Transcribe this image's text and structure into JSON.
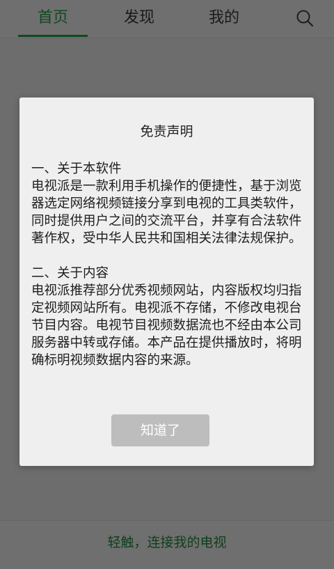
{
  "nav": {
    "tabs": [
      {
        "label": "首页"
      },
      {
        "label": "发现"
      },
      {
        "label": "我的"
      }
    ],
    "search_icon": "search-icon"
  },
  "dialog": {
    "title": "免责声明",
    "section1_heading": "一、关于本软件",
    "section1_body": "电视派是一款利用手机操作的便捷性，基于浏览器选定网络视频链接分享到电视的工具类软件，同时提供用户之间的交流平台，并享有合法软件著作权，受中华人民共和国相关法律法规保护。",
    "section2_heading": "二、关于内容",
    "section2_body": "电视派推荐部分优秀视频网站，内容版权均归指定视频网站所有。电视派不存储，不修改电视台节目内容。电视节目视频数据流也不经由本公司服务器中转或存储。本产品在提供播放时，将明确标明视频数据内容的来源。",
    "ok_label": "知道了"
  },
  "footer": {
    "text": "轻触，连接我的电视"
  },
  "colors": {
    "accent": "#0f4a1f",
    "overlay": "#6d6d6d",
    "dialog_bg": "#efefef",
    "button_bg": "#bdbdbd"
  }
}
